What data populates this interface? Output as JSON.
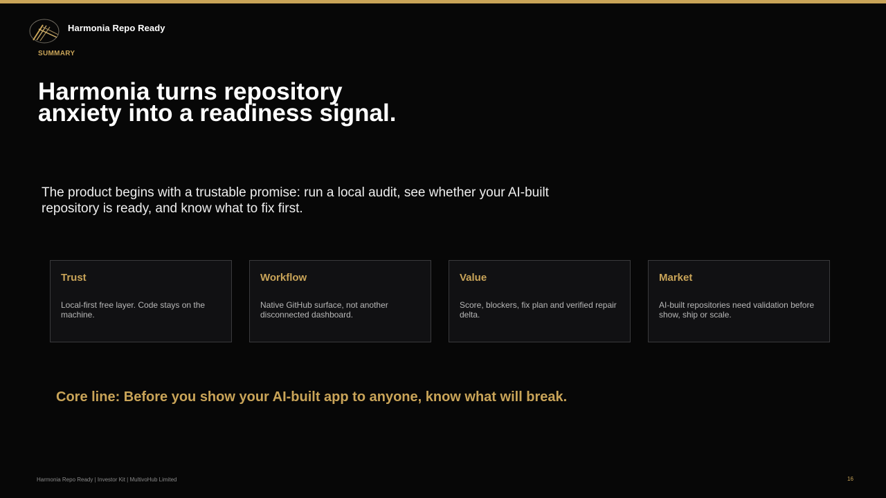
{
  "brand": {
    "name": "Harmonia Repo Ready",
    "logo_icon": "harmonia-logo-icon"
  },
  "section_label": "SUMMARY",
  "headline": "Harmonia turns repository anxiety into a readiness signal.",
  "intro": "The product begins with a trustable promise: run a local audit, see whether your AI-built repository is ready, and know what to fix first.",
  "cards": [
    {
      "title": "Trust",
      "body": "Local-first free layer. Code stays on the machine."
    },
    {
      "title": "Workflow",
      "body": "Native GitHub surface, not another disconnected dashboard."
    },
    {
      "title": "Value",
      "body": "Score, blockers, fix plan and verified repair delta."
    },
    {
      "title": "Market",
      "body": "AI-built repositories need validation before show, ship or scale."
    }
  ],
  "core_line": "Core line: Before you show your AI-built app to anyone, know what will break.",
  "footer": "Harmonia Repo Ready | Investor Kit | MultivoHub Limited",
  "page_number": "16",
  "colors": {
    "accent": "#c9a458",
    "background": "#070707",
    "card_background": "#111113",
    "card_border": "#3a3a3c"
  }
}
